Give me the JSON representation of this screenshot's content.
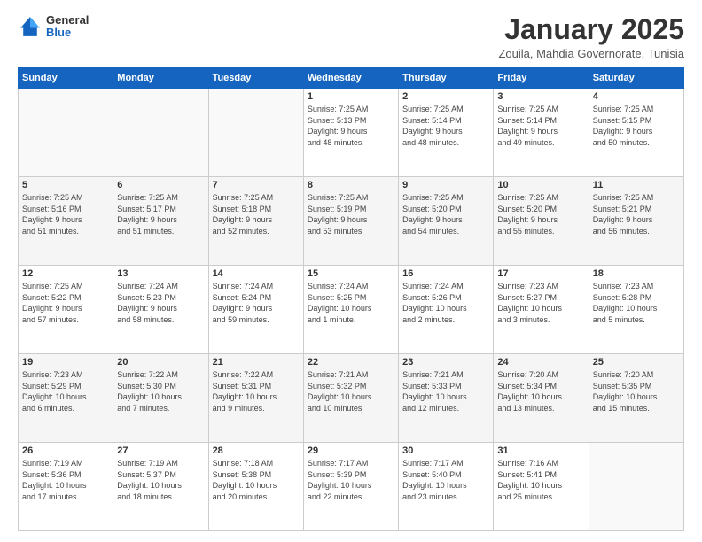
{
  "logo": {
    "general": "General",
    "blue": "Blue"
  },
  "header": {
    "title": "January 2025",
    "subtitle": "Zouila, Mahdia Governorate, Tunisia"
  },
  "weekdays": [
    "Sunday",
    "Monday",
    "Tuesday",
    "Wednesday",
    "Thursday",
    "Friday",
    "Saturday"
  ],
  "weeks": [
    [
      {
        "day": "",
        "info": ""
      },
      {
        "day": "",
        "info": ""
      },
      {
        "day": "",
        "info": ""
      },
      {
        "day": "1",
        "info": "Sunrise: 7:25 AM\nSunset: 5:13 PM\nDaylight: 9 hours\nand 48 minutes."
      },
      {
        "day": "2",
        "info": "Sunrise: 7:25 AM\nSunset: 5:14 PM\nDaylight: 9 hours\nand 48 minutes."
      },
      {
        "day": "3",
        "info": "Sunrise: 7:25 AM\nSunset: 5:14 PM\nDaylight: 9 hours\nand 49 minutes."
      },
      {
        "day": "4",
        "info": "Sunrise: 7:25 AM\nSunset: 5:15 PM\nDaylight: 9 hours\nand 50 minutes."
      }
    ],
    [
      {
        "day": "5",
        "info": "Sunrise: 7:25 AM\nSunset: 5:16 PM\nDaylight: 9 hours\nand 51 minutes."
      },
      {
        "day": "6",
        "info": "Sunrise: 7:25 AM\nSunset: 5:17 PM\nDaylight: 9 hours\nand 51 minutes."
      },
      {
        "day": "7",
        "info": "Sunrise: 7:25 AM\nSunset: 5:18 PM\nDaylight: 9 hours\nand 52 minutes."
      },
      {
        "day": "8",
        "info": "Sunrise: 7:25 AM\nSunset: 5:19 PM\nDaylight: 9 hours\nand 53 minutes."
      },
      {
        "day": "9",
        "info": "Sunrise: 7:25 AM\nSunset: 5:20 PM\nDaylight: 9 hours\nand 54 minutes."
      },
      {
        "day": "10",
        "info": "Sunrise: 7:25 AM\nSunset: 5:20 PM\nDaylight: 9 hours\nand 55 minutes."
      },
      {
        "day": "11",
        "info": "Sunrise: 7:25 AM\nSunset: 5:21 PM\nDaylight: 9 hours\nand 56 minutes."
      }
    ],
    [
      {
        "day": "12",
        "info": "Sunrise: 7:25 AM\nSunset: 5:22 PM\nDaylight: 9 hours\nand 57 minutes."
      },
      {
        "day": "13",
        "info": "Sunrise: 7:24 AM\nSunset: 5:23 PM\nDaylight: 9 hours\nand 58 minutes."
      },
      {
        "day": "14",
        "info": "Sunrise: 7:24 AM\nSunset: 5:24 PM\nDaylight: 9 hours\nand 59 minutes."
      },
      {
        "day": "15",
        "info": "Sunrise: 7:24 AM\nSunset: 5:25 PM\nDaylight: 10 hours\nand 1 minute."
      },
      {
        "day": "16",
        "info": "Sunrise: 7:24 AM\nSunset: 5:26 PM\nDaylight: 10 hours\nand 2 minutes."
      },
      {
        "day": "17",
        "info": "Sunrise: 7:23 AM\nSunset: 5:27 PM\nDaylight: 10 hours\nand 3 minutes."
      },
      {
        "day": "18",
        "info": "Sunrise: 7:23 AM\nSunset: 5:28 PM\nDaylight: 10 hours\nand 5 minutes."
      }
    ],
    [
      {
        "day": "19",
        "info": "Sunrise: 7:23 AM\nSunset: 5:29 PM\nDaylight: 10 hours\nand 6 minutes."
      },
      {
        "day": "20",
        "info": "Sunrise: 7:22 AM\nSunset: 5:30 PM\nDaylight: 10 hours\nand 7 minutes."
      },
      {
        "day": "21",
        "info": "Sunrise: 7:22 AM\nSunset: 5:31 PM\nDaylight: 10 hours\nand 9 minutes."
      },
      {
        "day": "22",
        "info": "Sunrise: 7:21 AM\nSunset: 5:32 PM\nDaylight: 10 hours\nand 10 minutes."
      },
      {
        "day": "23",
        "info": "Sunrise: 7:21 AM\nSunset: 5:33 PM\nDaylight: 10 hours\nand 12 minutes."
      },
      {
        "day": "24",
        "info": "Sunrise: 7:20 AM\nSunset: 5:34 PM\nDaylight: 10 hours\nand 13 minutes."
      },
      {
        "day": "25",
        "info": "Sunrise: 7:20 AM\nSunset: 5:35 PM\nDaylight: 10 hours\nand 15 minutes."
      }
    ],
    [
      {
        "day": "26",
        "info": "Sunrise: 7:19 AM\nSunset: 5:36 PM\nDaylight: 10 hours\nand 17 minutes."
      },
      {
        "day": "27",
        "info": "Sunrise: 7:19 AM\nSunset: 5:37 PM\nDaylight: 10 hours\nand 18 minutes."
      },
      {
        "day": "28",
        "info": "Sunrise: 7:18 AM\nSunset: 5:38 PM\nDaylight: 10 hours\nand 20 minutes."
      },
      {
        "day": "29",
        "info": "Sunrise: 7:17 AM\nSunset: 5:39 PM\nDaylight: 10 hours\nand 22 minutes."
      },
      {
        "day": "30",
        "info": "Sunrise: 7:17 AM\nSunset: 5:40 PM\nDaylight: 10 hours\nand 23 minutes."
      },
      {
        "day": "31",
        "info": "Sunrise: 7:16 AM\nSunset: 5:41 PM\nDaylight: 10 hours\nand 25 minutes."
      },
      {
        "day": "",
        "info": ""
      }
    ]
  ]
}
